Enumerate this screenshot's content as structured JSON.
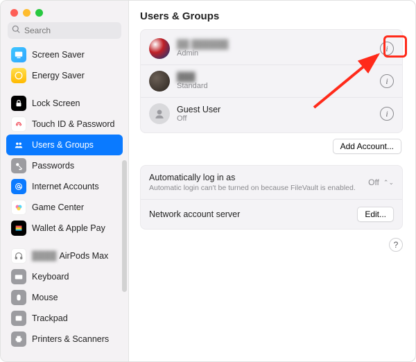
{
  "search": {
    "placeholder": "Search"
  },
  "sidebar": {
    "items": [
      {
        "label": "Screen Saver"
      },
      {
        "label": "Energy Saver"
      },
      {
        "label": "Lock Screen"
      },
      {
        "label": "Touch ID & Password"
      },
      {
        "label": "Users & Groups"
      },
      {
        "label": "Passwords"
      },
      {
        "label": "Internet Accounts"
      },
      {
        "label": "Game Center"
      },
      {
        "label": "Wallet & Apple Pay"
      },
      {
        "label": "AirPods Max"
      },
      {
        "label": "Keyboard"
      },
      {
        "label": "Mouse"
      },
      {
        "label": "Trackpad"
      },
      {
        "label": "Printers & Scanners"
      }
    ]
  },
  "main": {
    "title": "Users & Groups",
    "users": [
      {
        "name": "██ ██████",
        "role": "Admin"
      },
      {
        "name": "███",
        "role": "Standard"
      },
      {
        "name": "Guest User",
        "role": "Off"
      }
    ],
    "add_account": "Add Account...",
    "auto_login": {
      "label": "Automatically log in as",
      "sub": "Automatic login can't be turned on because FileVault is enabled.",
      "value": "Off"
    },
    "network_server": {
      "label": "Network account server",
      "button": "Edit..."
    },
    "help": "?"
  }
}
